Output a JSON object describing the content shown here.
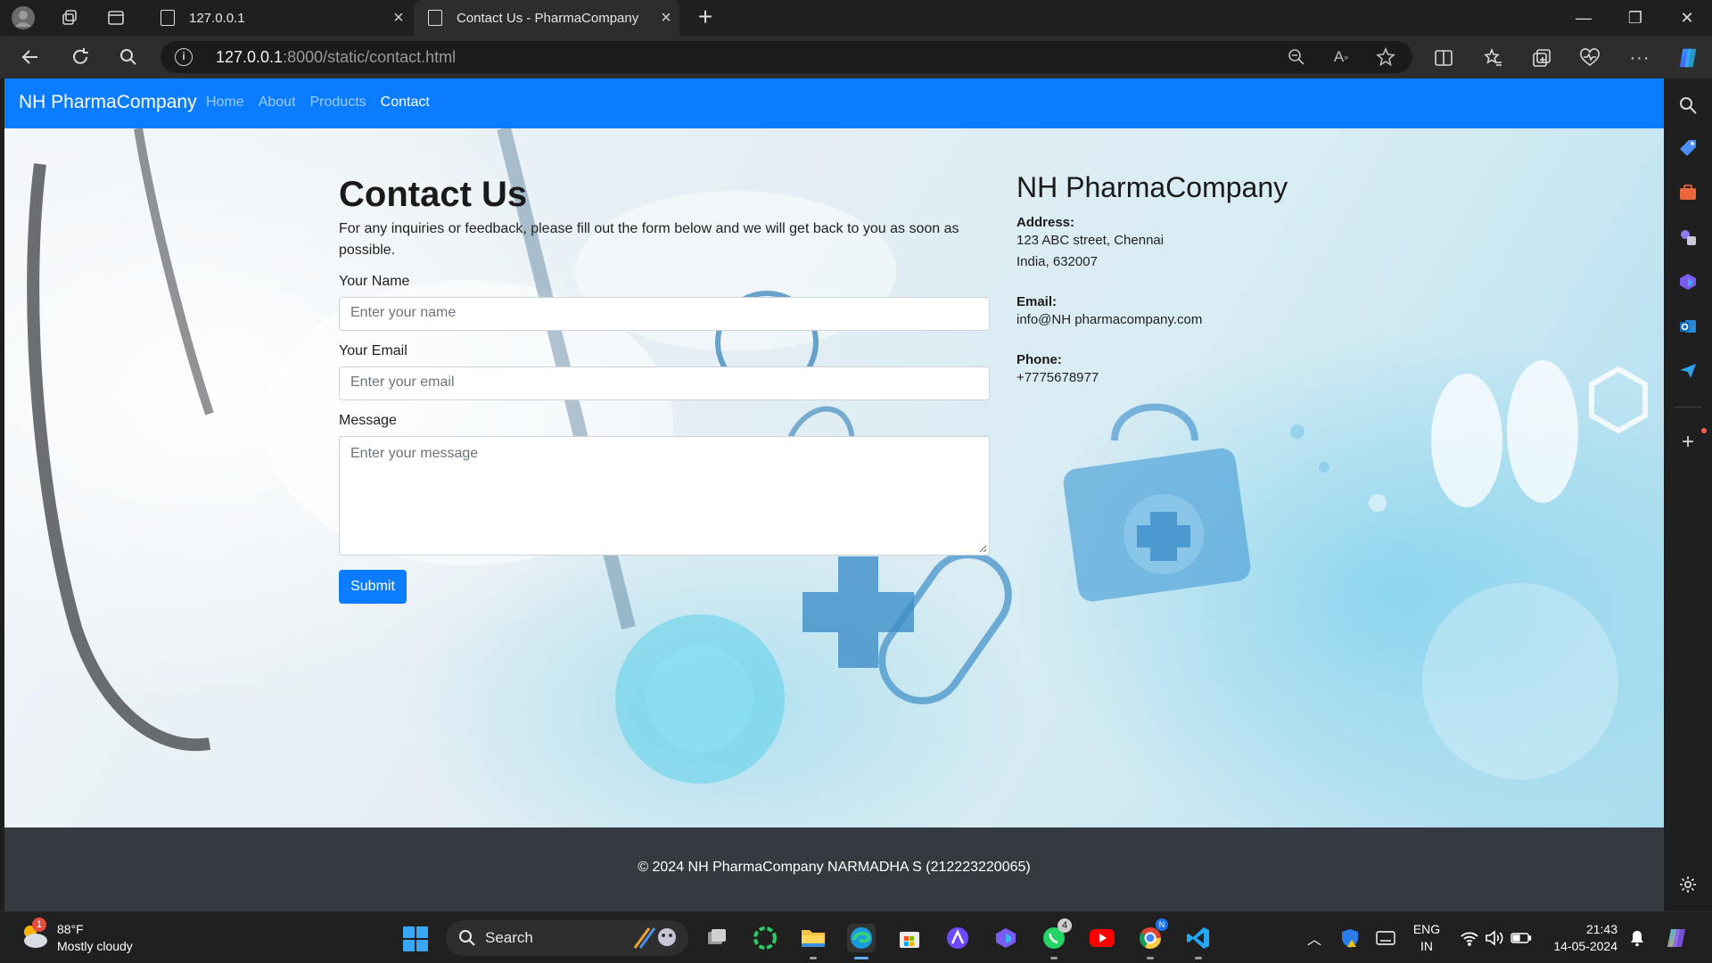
{
  "browser": {
    "tabs": [
      {
        "title": "127.0.0.1",
        "active": false
      },
      {
        "title": "Contact Us - PharmaCompany",
        "active": true
      }
    ],
    "url_host": "127.0.0.1",
    "url_path": ":8000/static/contact.html"
  },
  "page": {
    "navbar": {
      "brand": "NH PharmaCompany",
      "links": [
        "Home",
        "About",
        "Products",
        "Contact"
      ],
      "active_link": "Contact"
    },
    "contact": {
      "title": "Contact Us",
      "lead": "For any inquiries or feedback, please fill out the form below and we will get back to you as soon as possible.",
      "name_label": "Your Name",
      "name_placeholder": "Enter your name",
      "email_label": "Your Email",
      "email_placeholder": "Enter your email",
      "message_label": "Message",
      "message_placeholder": "Enter your message",
      "submit_label": "Submit"
    },
    "info": {
      "company": "NH PharmaCompany",
      "address_label": "Address:",
      "address_line1": "123 ABC street, Chennai",
      "address_line2": "India, 632007",
      "email_label": "Email:",
      "email": "info@NH pharmacompany.com",
      "phone_label": "Phone:",
      "phone": "+7775678977"
    },
    "footer": "© 2024 NH PharmaCompany NARMADHA S (212223220065)"
  },
  "taskbar": {
    "weather_temp": "88°F",
    "weather_desc": "Mostly cloudy",
    "weather_badge": "1",
    "search_label": "Search",
    "whatsapp_badge": "4",
    "language_line1": "ENG",
    "language_line2": "IN",
    "time": "21:43",
    "date": "14-05-2024"
  },
  "colors": {
    "navbar_bg": "#0a7cff",
    "footer_bg": "#343a40",
    "submit_bg": "#0a7cff"
  }
}
